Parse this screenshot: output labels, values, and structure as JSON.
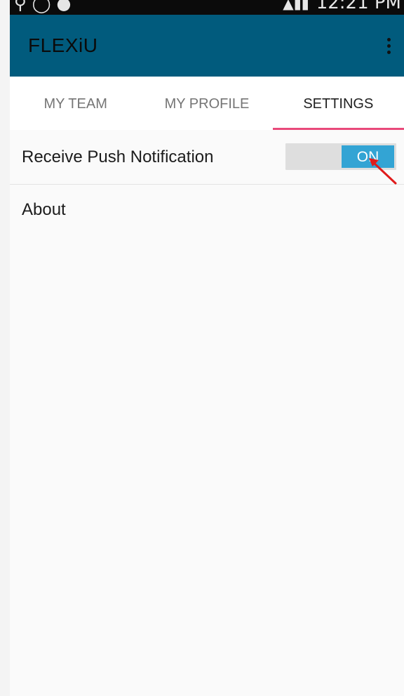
{
  "app": {
    "title": "FLEXiU",
    "colors": {
      "app_bar": "#015b7d",
      "tab_indicator": "#e9497a",
      "toggle_on": "#33a4d4",
      "annotation_arrow": "#e01b1b"
    }
  },
  "status_bar": {
    "left_icons": [
      "alarm-icon",
      "sync-icon",
      "notification-icon"
    ],
    "time": "12:21 PM"
  },
  "tabs": [
    {
      "label": "MY TEAM",
      "active": false
    },
    {
      "label": "MY PROFILE",
      "active": false
    },
    {
      "label": "SETTINGS",
      "active": true
    }
  ],
  "settings": {
    "push": {
      "label": "Receive Push Notification",
      "toggle_state": "ON"
    },
    "about": {
      "label": "About"
    }
  }
}
